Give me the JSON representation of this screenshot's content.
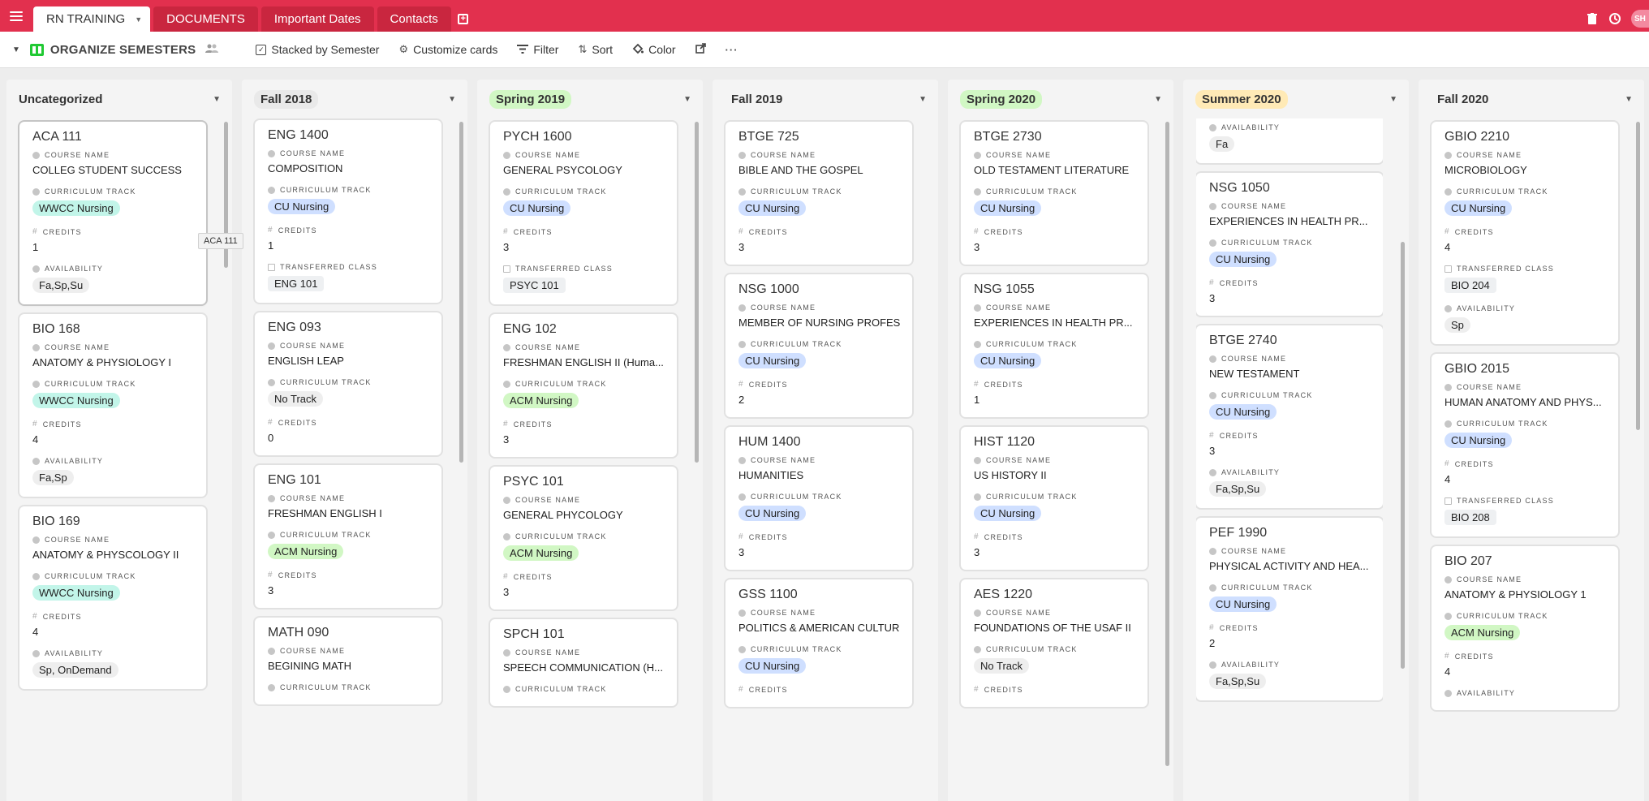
{
  "app": {
    "tabs": [
      {
        "label": "RN TRAINING"
      },
      {
        "label": "DOCUMENTS"
      },
      {
        "label": "Important Dates"
      },
      {
        "label": "Contacts"
      }
    ],
    "avatar_text": "SH"
  },
  "toolbar": {
    "view_name": "ORGANIZE SEMESTERS",
    "stacked_label": "Stacked by Semester",
    "customize_label": "Customize cards",
    "filter_label": "Filter",
    "sort_label": "Sort",
    "color_label": "Color"
  },
  "tooltip": "ACA 111",
  "field_labels": {
    "course_name": "COURSE NAME",
    "track": "CURRICULUM TRACK",
    "credits": "CREDITS",
    "availability": "AVAILABILITY",
    "transferred": "TRANSFERRED CLASS"
  },
  "columns": [
    {
      "title": "Uncategorized",
      "cards": [
        {
          "title": "ACA 111",
          "course": "COLLEG STUDENT SUCCESS",
          "track": "WWCC Nursing",
          "credits": "1",
          "availability": "Fa,Sp,Su"
        },
        {
          "title": "BIO 168",
          "course": "ANATOMY & PHYSIOLOGY I",
          "track": "WWCC Nursing",
          "credits": "4",
          "availability": "Fa,Sp"
        },
        {
          "title": "BIO 169",
          "course": "ANATOMY & PHYSCOLOGY II",
          "track": "WWCC Nursing",
          "credits": "4",
          "availability": "Sp, OnDemand"
        }
      ]
    },
    {
      "title": "Fall 2018",
      "cards": [
        {
          "title": "ENG 1400",
          "course": "COMPOSITION",
          "track": "CU Nursing",
          "credits": "1",
          "transferred": "ENG 101"
        },
        {
          "title": "ENG 093",
          "course": "ENGLISH LEAP",
          "track": "No Track",
          "credits": "0"
        },
        {
          "title": "ENG 101",
          "course": "FRESHMAN ENGLISH I",
          "track": "ACM Nursing",
          "credits": "3"
        },
        {
          "title": "MATH 090",
          "course": "BEGINING MATH",
          "track": ""
        }
      ]
    },
    {
      "title": "Spring 2019",
      "cards": [
        {
          "title": "PYCH 1600",
          "course": "GENERAL PSYCOLOGY",
          "track": "CU Nursing",
          "credits": "3",
          "transferred": "PSYC 101"
        },
        {
          "title": "ENG 102",
          "course": "FRESHMAN ENGLISH II (Huma...",
          "track": "ACM Nursing",
          "credits": "3"
        },
        {
          "title": "PSYC 101",
          "course": "GENERAL PHYCOLOGY",
          "track": "ACM Nursing",
          "credits": "3"
        },
        {
          "title": "SPCH 101",
          "course": "SPEECH COMMUNICATION (H...",
          "track": ""
        }
      ]
    },
    {
      "title": "Fall 2019",
      "cards": [
        {
          "title": "BTGE 725",
          "course": "BIBLE AND THE GOSPEL",
          "track": "CU Nursing",
          "credits": "3"
        },
        {
          "title": "NSG 1000",
          "course": "MEMBER OF NURSING PROFES...",
          "track": "CU Nursing",
          "credits": "2"
        },
        {
          "title": "HUM 1400",
          "course": "HUMANITIES",
          "track": "CU Nursing",
          "credits": "3"
        },
        {
          "title": "GSS 1100",
          "course": "POLITICS & AMERICAN CULTURE",
          "track": "CU Nursing",
          "credits": ""
        }
      ]
    },
    {
      "title": "Spring 2020",
      "cards": [
        {
          "title": "BTGE 2730",
          "course": "OLD TESTAMENT LITERATURE",
          "track": "CU Nursing",
          "credits": "3"
        },
        {
          "title": "NSG 1055",
          "course": "EXPERIENCES IN HEALTH PR...",
          "track": "CU Nursing",
          "credits": "1"
        },
        {
          "title": "HIST 1120",
          "course": "US HISTORY II",
          "track": "CU Nursing",
          "credits": "3"
        },
        {
          "title": "AES 1220",
          "course": "FOUNDATIONS OF THE USAF II",
          "track": "No Track",
          "credits": ""
        }
      ]
    },
    {
      "title": "Summer 2020",
      "partial_top": {
        "availability": "Fa"
      },
      "cards": [
        {
          "title": "NSG 1050",
          "course": "EXPERIENCES IN HEALTH PR...",
          "track": "CU Nursing",
          "credits": "3"
        },
        {
          "title": "BTGE 2740",
          "course": "NEW TESTAMENT",
          "track": "CU Nursing",
          "credits": "3",
          "availability": "Fa,Sp,Su"
        },
        {
          "title": "PEF 1990",
          "course": "PHYSICAL ACTIVITY AND HEA...",
          "track": "CU Nursing",
          "credits": "2",
          "availability": "Fa,Sp,Su"
        }
      ]
    },
    {
      "title": "Fall 2020",
      "cards": [
        {
          "title": "GBIO 2210",
          "course": "MICROBIOLOGY",
          "track": "CU Nursing",
          "credits": "4",
          "transferred": "BIO 204",
          "availability": "Sp"
        },
        {
          "title": "GBIO 2015",
          "course": "HUMAN ANATOMY AND PHYS...",
          "track": "CU Nursing",
          "credits": "4",
          "transferred": "BIO 208"
        },
        {
          "title": "BIO 207",
          "course": "ANATOMY & PHYSIOLOGY 1",
          "track": "ACM Nursing",
          "credits": "4",
          "availability": ""
        }
      ]
    }
  ]
}
